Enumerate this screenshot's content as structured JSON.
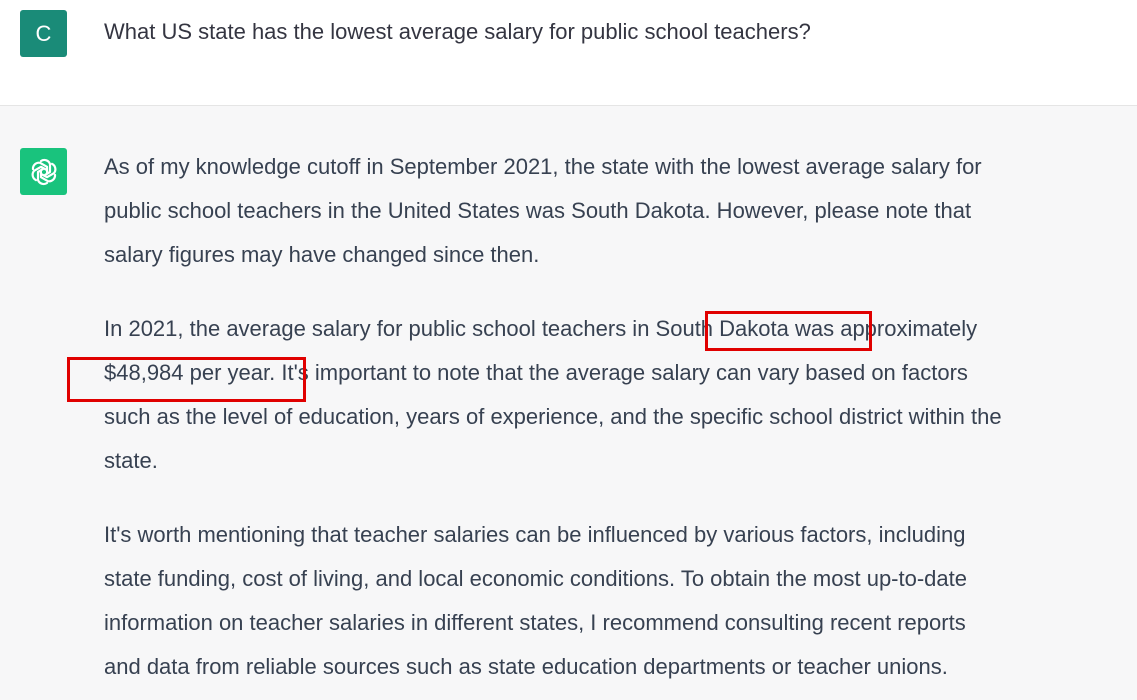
{
  "user_message": {
    "avatar_letter": "C",
    "text": "What US state has the lowest average salary for public school teachers?"
  },
  "assistant_message": {
    "avatar_icon": "openai-logo-icon",
    "paragraph1": [
      "As of my knowledge cutoff in September 2021, the state with the lowest average salary for",
      "public school teachers in the United States was South Dakota. However, please note that",
      "salary figures may have changed since then."
    ],
    "paragraph2": [
      "In 2021, the average salary for public school teachers in South Dakota was approximately",
      "$48,984 per year. It's important to note that the average salary can vary based on factors",
      "such as the level of education, years of experience, and the specific school district within the",
      "state."
    ],
    "paragraph3": [
      "It's worth mentioning that teacher salaries can be influenced by various factors, including",
      "state funding, cost of living, and local economic conditions. To obtain the most up-to-date",
      "information on teacher salaries in different states, I recommend consulting recent reports",
      "and data from reliable sources such as state education departments or teacher unions."
    ]
  },
  "colors": {
    "user_avatar": "#1a8b78",
    "assistant_avatar": "#19c37d",
    "assistant_background": "#f7f7f8",
    "highlight_box": "#e00000"
  }
}
